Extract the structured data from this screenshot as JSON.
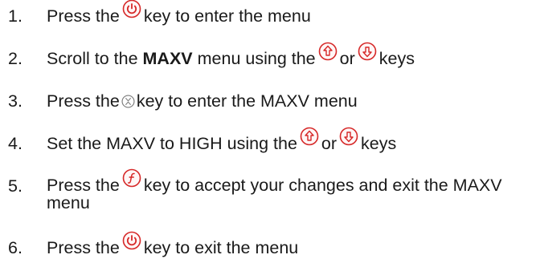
{
  "steps": [
    {
      "number": "1.",
      "pre": "Press the",
      "icon": "power-key-icon",
      "post": "key to enter the menu"
    },
    {
      "number": "2.",
      "pre": "Scroll to the",
      "bold": "MAXV",
      "mid": "menu using the",
      "icon_a": "up-arrow-key-icon",
      "or": "or",
      "icon_b": "down-arrow-key-icon",
      "post": "keys"
    },
    {
      "number": "3.",
      "pre": "Press the",
      "icon": "enter-key-icon",
      "post": "key to enter the MAXV menu"
    },
    {
      "number": "4.",
      "pre": "Set the MAXV to HIGH using the",
      "icon_a": "up-arrow-key-icon",
      "or": "or",
      "icon_b": "down-arrow-key-icon",
      "post": "keys"
    },
    {
      "number": "5.",
      "pre": "Press the",
      "icon": "function-key-icon",
      "post": "key to accept your changes and exit the MAXV menu"
    },
    {
      "number": "6.",
      "pre": "Press the",
      "icon": "power-key-icon",
      "post": "key to exit the menu"
    }
  ],
  "colors": {
    "icon_red": "#d62828",
    "icon_fill": "#fff6f6",
    "enter_gray": "#7a7a7a"
  }
}
